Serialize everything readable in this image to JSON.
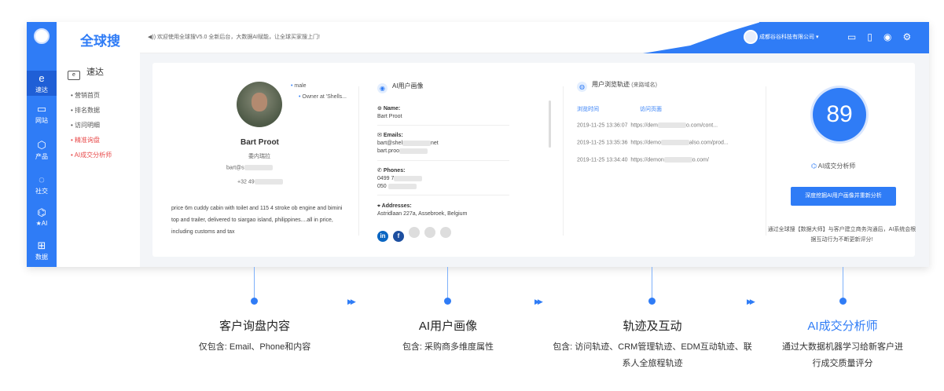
{
  "app": {
    "logo": "全球搜",
    "notice": "◀)) 欢迎使用全球搜V5.0 全新后台，大数据AI赋能，让全球买家搜上门!",
    "company": "成都谷谷科技有限公司 ▾"
  },
  "iconbar": [
    {
      "label": "速达",
      "icon": "e-icon"
    },
    {
      "label": "网站",
      "icon": "monitor-icon"
    },
    {
      "label": "产品",
      "icon": "cube-icon"
    },
    {
      "label": "社交",
      "icon": "chat-icon"
    },
    {
      "label": "★AI",
      "icon": "robot-icon"
    },
    {
      "label": "数据",
      "icon": "data-icon"
    }
  ],
  "submenu": {
    "header": "速达",
    "items": [
      "营销首页",
      "排名数据",
      "访问明细",
      "精准询盘",
      "AI成交分析师"
    ]
  },
  "profile": {
    "tags": [
      "male",
      "Owner at 'Shells..."
    ],
    "name": "Bart Proot",
    "role": "委内瑞拉",
    "email": "bart@s",
    "phone": "+32 49",
    "desc": "price 6m cuddy cabin with toilet and 115 4 stroke ob engine and bimini top and trailer, delivered to siargao island, philippines....all in price, including customs and tax"
  },
  "portrait": {
    "title": "AI用户画像",
    "name_label": "Name:",
    "name": "Bart Proot",
    "emails_label": "Emails:",
    "email1": "bart@shel",
    "email1_end": "net",
    "email2": "bart.proo",
    "phones_label": "Phones:",
    "phone1": "0499 7",
    "phone2": "050 ",
    "addr_label": "Addresses:",
    "addr": "Astridlaan 227a, Assebroek, Belgium"
  },
  "track": {
    "title": "用户浏览轨迹",
    "sub": "(来路域名)",
    "col_time": "浏览时间",
    "col_page": "访问页面",
    "rows": [
      {
        "time": "2019-11-25 13:36:07",
        "url": "https://dem",
        "end": "o.com/cont..."
      },
      {
        "time": "2019-11-25 13:35:36",
        "url": "https://demo",
        "end": "also.com/prod..."
      },
      {
        "time": "2019-11-25 13:34:40",
        "url": "https://demon",
        "end": "o.com/"
      }
    ]
  },
  "ai": {
    "score": "89",
    "label": "AI成交分析师",
    "button": "深度挖掘AI用户画像并重新分析",
    "note": "通过全球搜【数据大师】与客户建立商务沟通后，AI系统会根据互动行为不断更新评分!"
  },
  "features": [
    {
      "title": "客户询盘内容",
      "desc": "仅包含: Email、Phone和内容"
    },
    {
      "title": "AI用户画像",
      "desc": "包含: 采购商多维度属性"
    },
    {
      "title": "轨迹及互动",
      "desc": "包含: 访问轨迹、CRM管理轨迹、EDM互动轨迹、联系人全旅程轨迹"
    },
    {
      "title": "AI成交分析师",
      "desc": "通过大数据机器学习给新客户进行成交质量评分"
    }
  ],
  "colors": {
    "accent": "#2f7cf6",
    "red": "#e84b4b"
  }
}
